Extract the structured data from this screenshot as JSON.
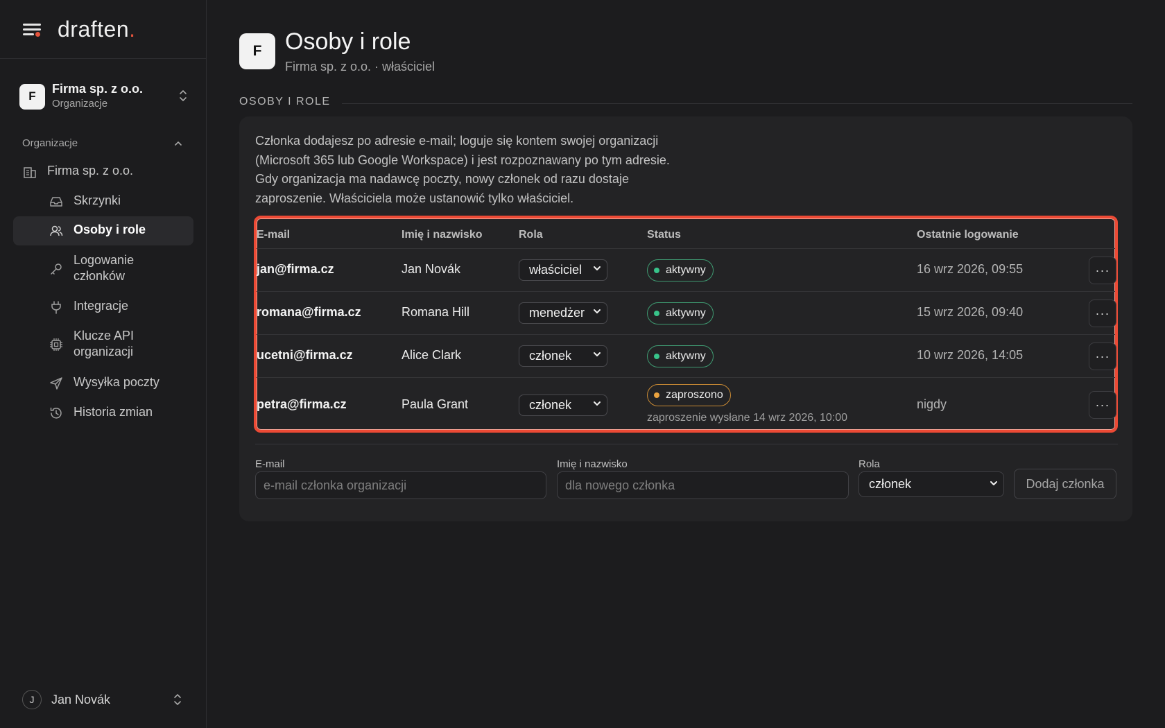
{
  "brand": {
    "name": "draften",
    "accent": "."
  },
  "colors": {
    "accent": "#e5543d",
    "active": "#38c38a",
    "invited": "#eaa33f",
    "highlight": "#ec4a35"
  },
  "org_switcher": {
    "avatar": "F",
    "name": "Firma sp. z o.o.",
    "sub": "Organizacje"
  },
  "sidebar": {
    "section_title": "Organizacje",
    "org_item": "Firma sp. z o.o.",
    "items": [
      {
        "label": "Skrzynki",
        "icon": "inbox-icon"
      },
      {
        "label": "Osoby i role",
        "icon": "users-icon",
        "active": true
      },
      {
        "label": "Logowanie\nczłonków",
        "icon": "key-icon"
      },
      {
        "label": "Integracje",
        "icon": "plug-icon"
      },
      {
        "label": "Klucze API\norganizacji",
        "icon": "chip-icon"
      },
      {
        "label": "Wysyłka poczty",
        "icon": "send-icon"
      },
      {
        "label": "Historia zmian",
        "icon": "history-icon"
      }
    ]
  },
  "user": {
    "initial": "J",
    "name": "Jan Novák"
  },
  "page": {
    "avatar": "F",
    "title": "Osoby i role",
    "subtitle": "Firma sp. z o.o. · właściciel",
    "section_label": "OSOBY I ROLE",
    "description": "Członka dodajesz po adresie e-mail; loguje się kontem swojej organizacji (Microsoft 365 lub Google Workspace) i jest rozpoznawany po tym adresie. Gdy organizacja ma nadawcę poczty, nowy członek od razu dostaje zaproszenie. Właściciela może ustanowić tylko właściciel."
  },
  "table": {
    "headers": {
      "email": "E-mail",
      "name": "Imię i nazwisko",
      "role": "Rola",
      "status": "Status",
      "last_login": "Ostatnie logowanie"
    },
    "rows": [
      {
        "email": "jan@firma.cz",
        "name": "Jan Novák",
        "role": "właściciel",
        "status": "aktywny",
        "last_login": "16 wrz 2026, 09:55"
      },
      {
        "email": "romana@firma.cz",
        "name": "Romana Hill",
        "role": "menedżer",
        "status": "aktywny",
        "last_login": "15 wrz 2026, 09:40"
      },
      {
        "email": "ucetni@firma.cz",
        "name": "Alice Clark",
        "role": "członek",
        "status": "aktywny",
        "last_login": "10 wrz 2026, 14:05"
      },
      {
        "email": "petra@firma.cz",
        "name": "Paula Grant",
        "role": "członek",
        "status": "zaproszono",
        "note": "zaproszenie wysłane 14 wrz 2026, 10:00",
        "last_login": "nigdy"
      }
    ],
    "more_label": "···"
  },
  "form": {
    "email_label": "E-mail",
    "email_placeholder": "e-mail członka organizacji",
    "name_label": "Imię i nazwisko",
    "name_placeholder": "dla nowego członka",
    "role_label": "Rola",
    "role_value": "członek",
    "submit": "Dodaj członka"
  }
}
